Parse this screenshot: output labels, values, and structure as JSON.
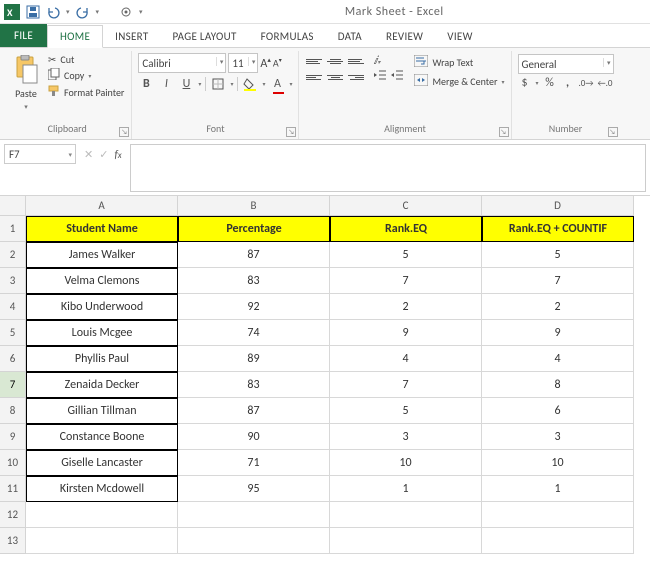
{
  "title": "Mark Sheet - Excel",
  "qat": {
    "save": "Save",
    "undo": "Undo",
    "redo": "Redo",
    "touch": "Touch/Mouse Mode"
  },
  "tabs": [
    "FILE",
    "HOME",
    "INSERT",
    "PAGE LAYOUT",
    "FORMULAS",
    "DATA",
    "REVIEW",
    "VIEW"
  ],
  "ribbon": {
    "clipboard": {
      "paste": "Paste",
      "cut": "Cut",
      "copy": "Copy",
      "painter": "Format Painter",
      "label": "Clipboard"
    },
    "font": {
      "name": "Calibri",
      "size": "11",
      "label": "Font"
    },
    "alignment": {
      "wrap": "Wrap Text",
      "merge": "Merge & Center",
      "label": "Alignment"
    },
    "number": {
      "format": "General",
      "label": "Number"
    }
  },
  "namebox": "F7",
  "columns": [
    "A",
    "B",
    "C",
    "D"
  ],
  "header_cells": [
    "Student Name",
    "Percentage",
    "Rank.EQ",
    "Rank.EQ + COUNTIF"
  ],
  "rows": [
    {
      "n": "2",
      "a": "James Walker",
      "b": "87",
      "c": "5",
      "d": "5"
    },
    {
      "n": "3",
      "a": "Velma Clemons",
      "b": "83",
      "c": "7",
      "d": "7"
    },
    {
      "n": "4",
      "a": "Kibo Underwood",
      "b": "92",
      "c": "2",
      "d": "2"
    },
    {
      "n": "5",
      "a": "Louis Mcgee",
      "b": "74",
      "c": "9",
      "d": "9"
    },
    {
      "n": "6",
      "a": "Phyllis Paul",
      "b": "89",
      "c": "4",
      "d": "4"
    },
    {
      "n": "7",
      "a": "Zenaida Decker",
      "b": "83",
      "c": "7",
      "d": "8"
    },
    {
      "n": "8",
      "a": "Gillian Tillman",
      "b": "87",
      "c": "5",
      "d": "6"
    },
    {
      "n": "9",
      "a": "Constance Boone",
      "b": "90",
      "c": "3",
      "d": "3"
    },
    {
      "n": "10",
      "a": "Giselle Lancaster",
      "b": "71",
      "c": "10",
      "d": "10"
    },
    {
      "n": "11",
      "a": "Kirsten Mcdowell",
      "b": "95",
      "c": "1",
      "d": "1"
    }
  ],
  "selected_row": "7",
  "chart_data": {
    "type": "table",
    "columns": [
      "Student Name",
      "Percentage",
      "Rank.EQ",
      "Rank.EQ + COUNTIF"
    ],
    "data": [
      [
        "James Walker",
        87,
        5,
        5
      ],
      [
        "Velma Clemons",
        83,
        7,
        7
      ],
      [
        "Kibo Underwood",
        92,
        2,
        2
      ],
      [
        "Louis Mcgee",
        74,
        9,
        9
      ],
      [
        "Phyllis Paul",
        89,
        4,
        4
      ],
      [
        "Zenaida Decker",
        83,
        7,
        8
      ],
      [
        "Gillian Tillman",
        87,
        5,
        6
      ],
      [
        "Constance Boone",
        90,
        3,
        3
      ],
      [
        "Giselle Lancaster",
        71,
        10,
        10
      ],
      [
        "Kirsten Mcdowell",
        95,
        1,
        1
      ]
    ]
  }
}
